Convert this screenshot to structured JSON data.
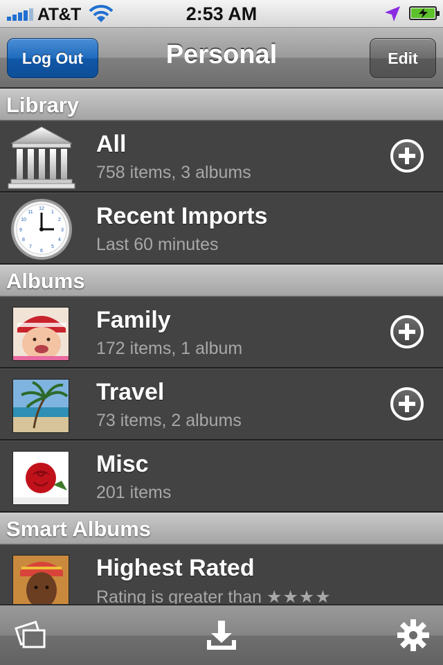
{
  "status_bar": {
    "carrier": "AT&T",
    "time": "2:53 AM"
  },
  "nav": {
    "title": "Personal",
    "left_button": "Log Out",
    "right_button": "Edit"
  },
  "sections": {
    "library": {
      "header": "Library",
      "rows": [
        {
          "title": "All",
          "subtitle": "758 items, 3 albums",
          "icon": "library-building-icon",
          "add": true
        },
        {
          "title": "Recent Imports",
          "subtitle": "Last 60 minutes",
          "icon": "clock-icon",
          "add": false
        }
      ]
    },
    "albums": {
      "header": "Albums",
      "rows": [
        {
          "title": "Family",
          "subtitle": "172 items, 1 album",
          "thumb": "baby-photo",
          "add": true
        },
        {
          "title": "Travel",
          "subtitle": "73 items, 2 albums",
          "thumb": "beach-photo",
          "add": true
        },
        {
          "title": "Misc",
          "subtitle": "201 items",
          "thumb": "rose-photo",
          "add": false
        }
      ]
    },
    "smart_albums": {
      "header": "Smart Albums",
      "rows": [
        {
          "title": "Highest Rated",
          "subtitle": "Rating is greater than",
          "stars": "★★★★",
          "thumb": "portrait-photo"
        }
      ]
    }
  },
  "tab_bar": {
    "items": [
      "albums-stack-icon",
      "download-icon",
      "gear-icon"
    ]
  },
  "colors": {
    "accent_blue": "#1f6bbd",
    "row_bg": "#434343",
    "subtitle": "#a8a8a8"
  }
}
